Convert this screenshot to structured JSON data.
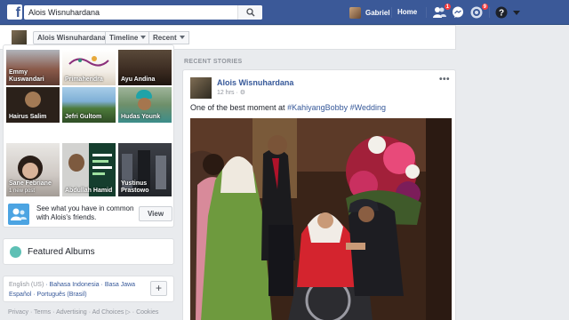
{
  "topbar": {
    "logo": "f",
    "search_value": "Alois Wisnuhardana",
    "user_name": "Gabriel",
    "home_label": "Home",
    "friend_requests_count": "1",
    "notifications_count": "9",
    "icons": [
      "facebook-logo",
      "search-icon",
      "friend-requests-icon",
      "messenger-icon",
      "notifications-icon",
      "help-icon",
      "chevron-down-icon"
    ]
  },
  "timeline_bar": {
    "name": "Alois Wisnuhardana",
    "timeline_label": "Timeline",
    "recent_label": "Recent"
  },
  "friends": [
    {
      "name": "Emmy Kuswandari",
      "sub": ""
    },
    {
      "name": "Primahendra",
      "sub": ""
    },
    {
      "name": "Ayu Andina",
      "sub": ""
    },
    {
      "name": "Hairus Salim",
      "sub": ""
    },
    {
      "name": "Jefri Gultom",
      "sub": ""
    },
    {
      "name": "Hudas Younk",
      "sub": ""
    },
    {
      "name": "Sane Febriane",
      "sub": "1 new post"
    },
    {
      "name": "Abdullah Hamid",
      "sub": ""
    },
    {
      "name": "Yustinus Prastowo",
      "sub": ""
    }
  ],
  "common_friends": {
    "text": "See what you have in common with Alois's friends.",
    "view_label": "View"
  },
  "featured_albums": {
    "title": "Featured Albums"
  },
  "languages": {
    "current": "English (US)",
    "others": [
      "Bahasa Indonesia",
      "Basa Jawa",
      "Español",
      "Português (Brasil)"
    ],
    "add_label": "+"
  },
  "footer": [
    "Privacy",
    "Terms",
    "Advertising",
    "Ad Choices",
    "Cookies"
  ],
  "recent_stories_label": "RECENT STORIES",
  "post": {
    "author": "Alois Wisnuhardana",
    "time": "12 hrs",
    "more": "•••",
    "text_prefix": "One of the best moment at ",
    "hashtags": "#KahiyangBobby #Wedding"
  },
  "colors": {
    "brand": "#3b5998",
    "link": "#365899",
    "badge": "#fa3e3e",
    "background": "#e9ebee"
  }
}
